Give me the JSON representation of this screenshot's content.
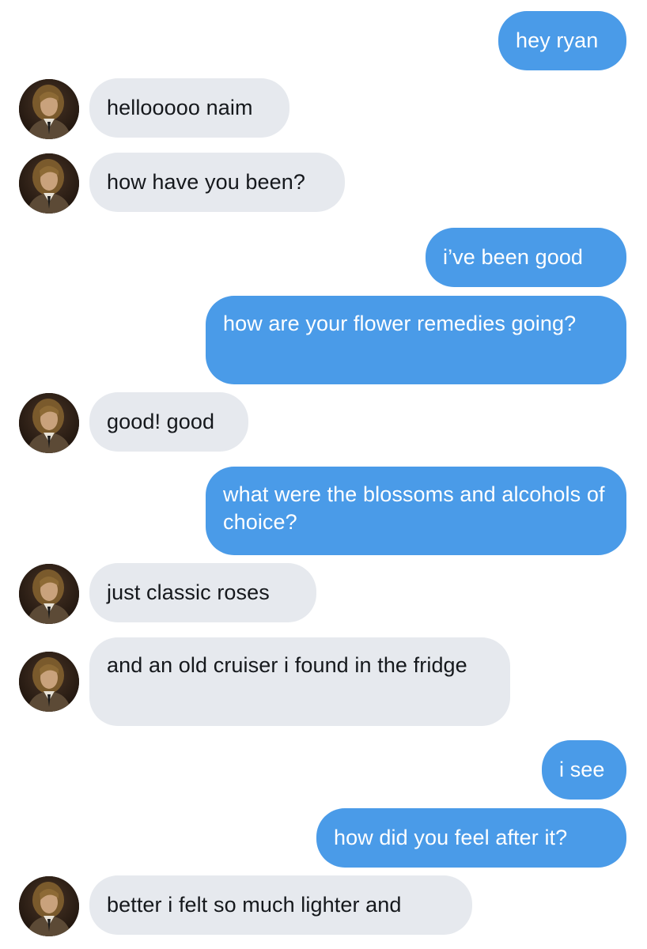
{
  "conversation": {
    "contact_avatar_icon": "avatar-portrait-icon",
    "colors": {
      "sent_bubble": "#4a9be8",
      "received_bubble": "#e6e9ee",
      "background": "#ffffff"
    },
    "messages": [
      {
        "sender": "me",
        "text": "hey ryan"
      },
      {
        "sender": "contact",
        "text": "hellooooo naim"
      },
      {
        "sender": "contact",
        "text": "how have you been?"
      },
      {
        "sender": "me",
        "text": "i’ve been good"
      },
      {
        "sender": "me",
        "text": "how are your flower remedies going?"
      },
      {
        "sender": "contact",
        "text": "good! good"
      },
      {
        "sender": "me",
        "text": "what were the blossoms and alcohols of choice?"
      },
      {
        "sender": "contact",
        "text": "just classic roses"
      },
      {
        "sender": "contact",
        "text": "and an old cruiser i found in the fridge"
      },
      {
        "sender": "me",
        "text": "i see"
      },
      {
        "sender": "me",
        "text": "how did you feel after it?"
      },
      {
        "sender": "contact",
        "text": "better i felt so much lighter and"
      }
    ]
  }
}
